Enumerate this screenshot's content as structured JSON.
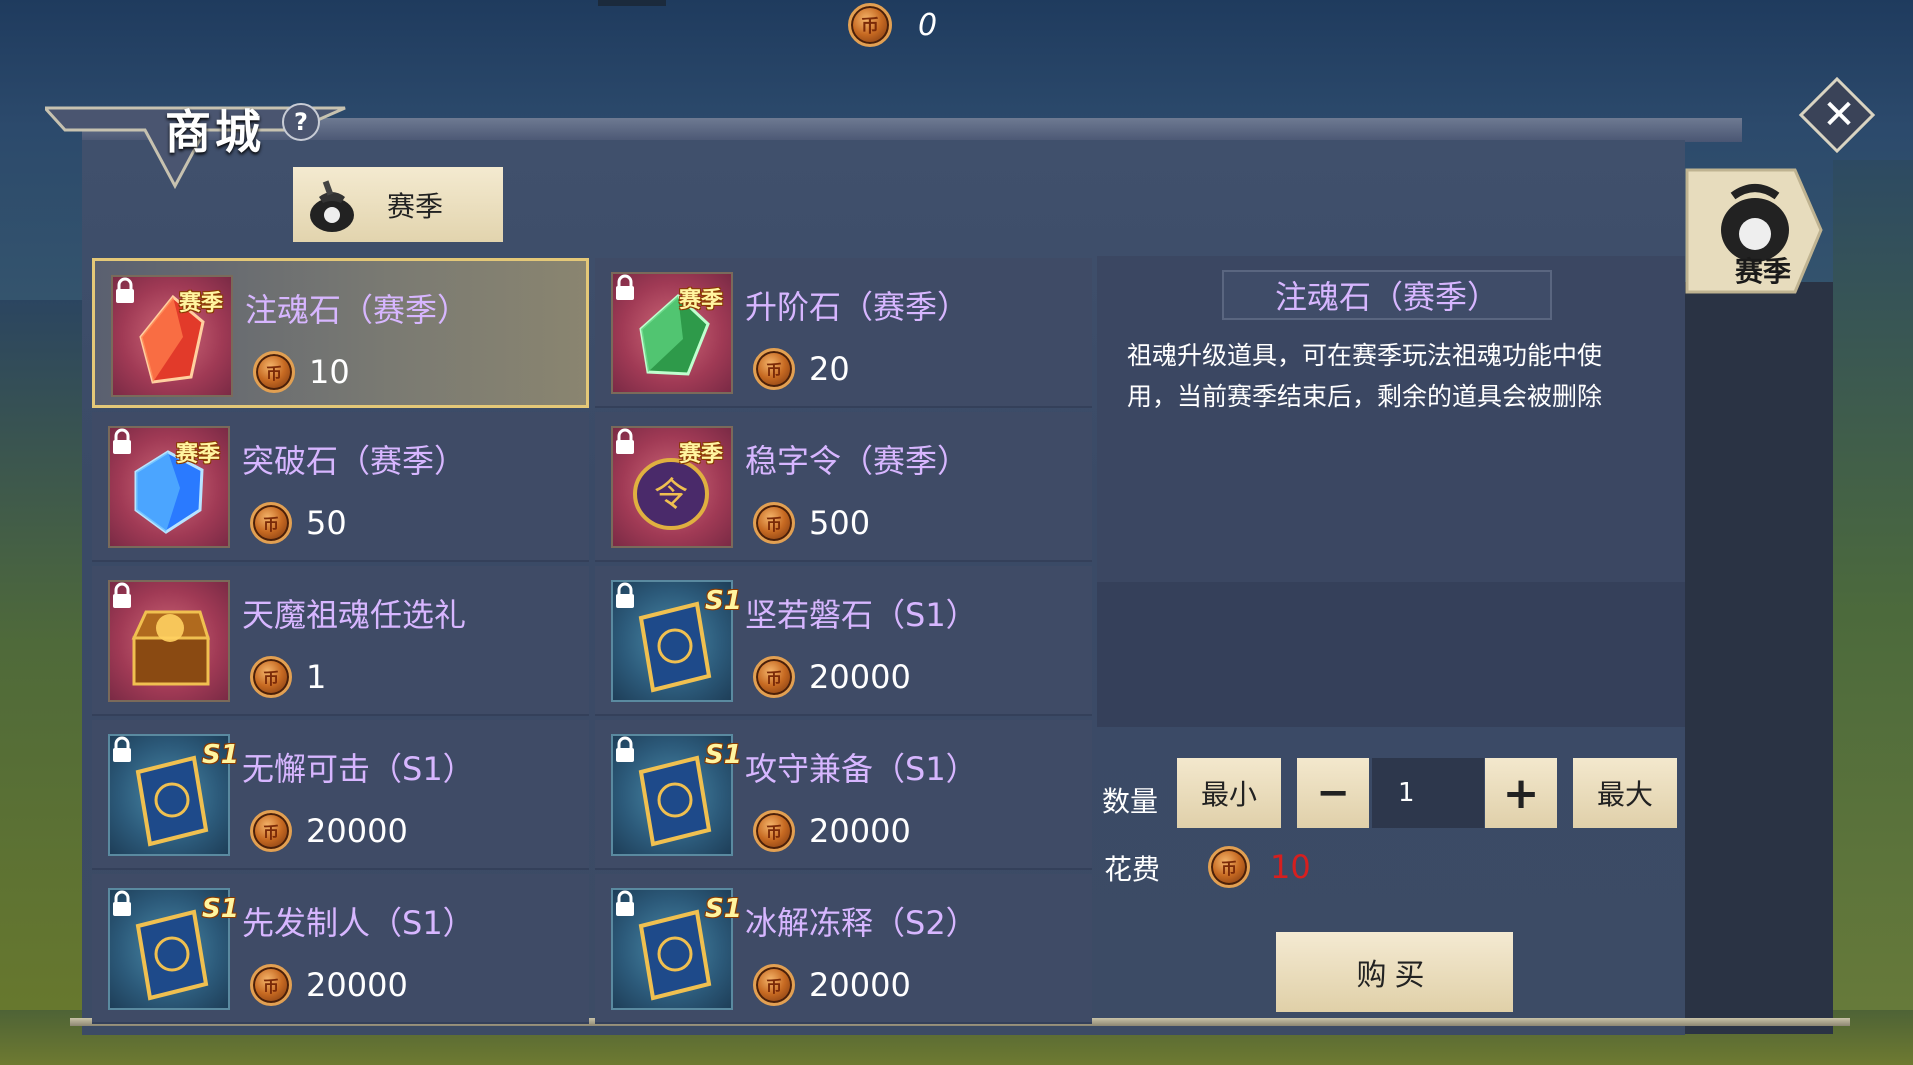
{
  "top_bar": {
    "currency_icon": "season-coin-icon",
    "currency_amount": "0"
  },
  "header": {
    "title": "商城",
    "help_label": "?",
    "close_label": "✕"
  },
  "category_tabs": [
    {
      "label": "赛季",
      "icon": "season-bag-icon"
    }
  ],
  "side_tab": {
    "label": "赛季",
    "icon": "season-bag-icon"
  },
  "items": [
    {
      "name": "注魂石（赛季）",
      "price": "10",
      "badge": "赛季",
      "icon": "red-crystal-icon",
      "selected": true
    },
    {
      "name": "升阶石（赛季）",
      "price": "20",
      "badge": "赛季",
      "icon": "green-crystal-icon",
      "selected": false
    },
    {
      "name": "突破石（赛季）",
      "price": "50",
      "badge": "赛季",
      "icon": "blue-gem-icon",
      "selected": false
    },
    {
      "name": "稳字令（赛季）",
      "price": "500",
      "badge": "赛季",
      "icon": "token-plaque-icon",
      "selected": false
    },
    {
      "name": "天魔祖魂任选礼",
      "price": "1",
      "badge": "",
      "icon": "treasure-chest-icon",
      "selected": false
    },
    {
      "name": "坚若磐石（S1）",
      "price": "20000",
      "badge": "S1",
      "icon": "skill-book-icon",
      "selected": false
    },
    {
      "name": "无懈可击（S1）",
      "price": "20000",
      "badge": "S1",
      "icon": "skill-book-icon",
      "selected": false
    },
    {
      "name": "攻守兼备（S1）",
      "price": "20000",
      "badge": "S1",
      "icon": "skill-book-icon",
      "selected": false
    },
    {
      "name": "先发制人（S1）",
      "price": "20000",
      "badge": "S1",
      "icon": "skill-book-icon",
      "selected": false
    },
    {
      "name": "冰解冻释（S2）",
      "price": "20000",
      "badge": "S1",
      "icon": "skill-book-icon",
      "selected": false
    }
  ],
  "detail": {
    "title": "注魂石（赛季）",
    "description": "祖魂升级道具，可在赛季玩法祖魂功能中使用，当前赛季结束后，剩余的道具会被删除"
  },
  "purchase": {
    "quantity_label": "数量",
    "min_label": "最小",
    "minus_label": "−",
    "quantity_value": "1",
    "plus_label": "+",
    "max_label": "最大",
    "cost_label": "花费",
    "cost_value": "10",
    "cost_color": "#d61f1f",
    "buy_label": "购买"
  },
  "colors": {
    "item_name": "#d7b6ff",
    "selected_border": "#e4c878"
  }
}
